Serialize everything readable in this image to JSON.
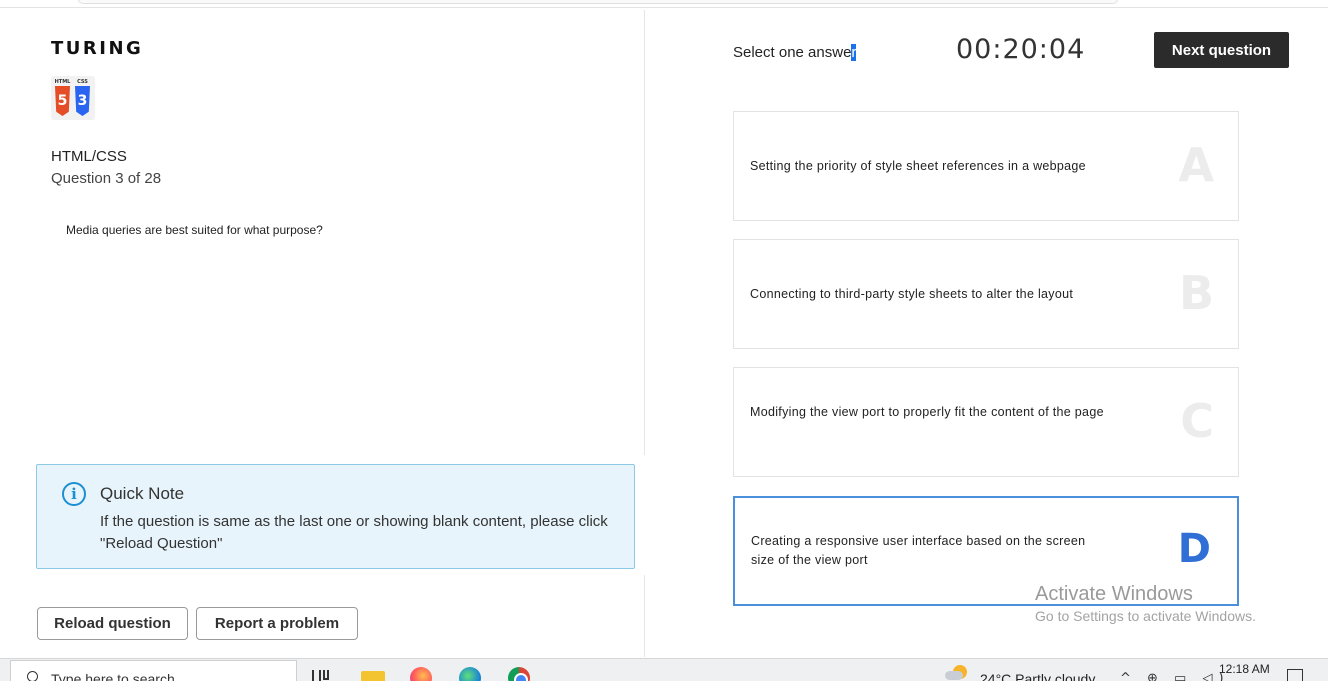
{
  "brand": {
    "logo_text": "TURING",
    "tech_captions": [
      "HTML",
      "CSS"
    ],
    "html_glyph": "5",
    "css_glyph": "3"
  },
  "quiz": {
    "category": "HTML/CSS",
    "progress": "Question 3 of 28",
    "question": "Media queries are best suited for what purpose?"
  },
  "note": {
    "info_glyph": "i",
    "title": "Quick Note",
    "body": "If the question is same as the last one or showing blank content, please click \"Reload Question\""
  },
  "actions": {
    "reload_label": "Reload question",
    "report_label": "Report a problem"
  },
  "answer_panel": {
    "select_label_main": "Select one answe",
    "select_label_selected": "r",
    "timer": "00:20:04",
    "next_label": "Next question"
  },
  "options": [
    {
      "letter": "A",
      "text": "Setting the priority of style sheet references in a webpage",
      "selected": false
    },
    {
      "letter": "B",
      "text": "Connecting to third-party style sheets to alter the layout",
      "selected": false
    },
    {
      "letter": "C",
      "text": "Modifying the view port to properly fit the content of the page",
      "selected": false
    },
    {
      "letter": "D",
      "text": "Creating a responsive user interface based on the screen size of the view port",
      "selected": true
    }
  ],
  "watermark": {
    "line1": "Activate Windows",
    "line2": "Go to Settings to activate Windows."
  },
  "taskbar": {
    "search_placeholder": "Type here to search",
    "weather": "24°C  Partly cloudy",
    "tray_icons": "^ ⊕ ▭ ◁)",
    "time": "12:18 AM"
  },
  "colors": {
    "accent": "#2f6fd6",
    "note_bg": "#e7f4fb",
    "note_border": "#8cc9e6",
    "next_button": "#2b2b2b"
  }
}
